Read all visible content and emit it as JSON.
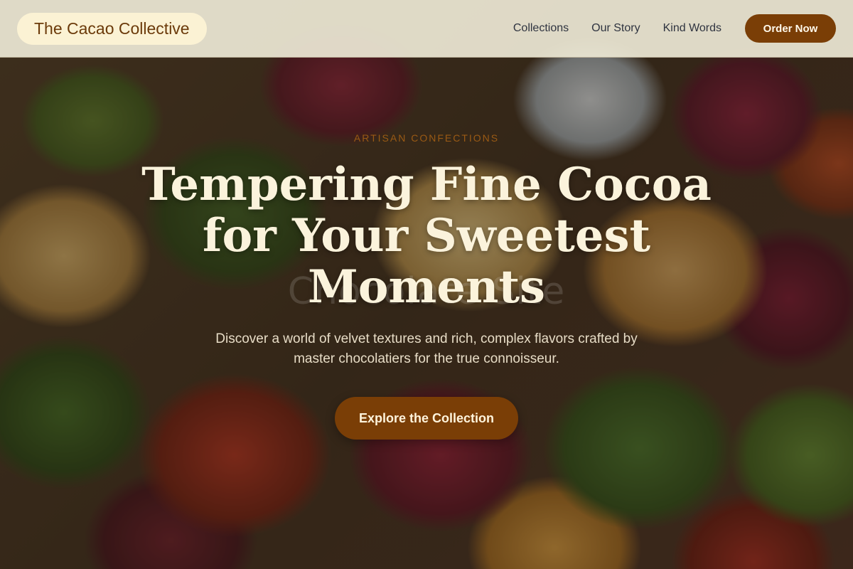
{
  "header": {
    "brand": "The Cacao Collective",
    "nav": [
      {
        "label": "Collections"
      },
      {
        "label": "Our Story"
      },
      {
        "label": "Kind Words"
      }
    ],
    "order_button": "Order Now"
  },
  "hero": {
    "eyebrow": "Artisan Confections",
    "headline_line1": "Tempering Fine Cocoa",
    "headline_line2": "for Your Sweetest",
    "headline_line3": "Moments",
    "subtext": "Discover a world of velvet textures and rich, complex flavors crafted by master chocolatiers for the true connoisseur.",
    "cta": "Explore the Collection",
    "background_watermark": "Chocolate Site"
  },
  "colors": {
    "accent": "#7a3e06",
    "headline": "#fbf3dc",
    "eyebrow": "#9a5a14",
    "header_bg": "#ece7d4"
  }
}
